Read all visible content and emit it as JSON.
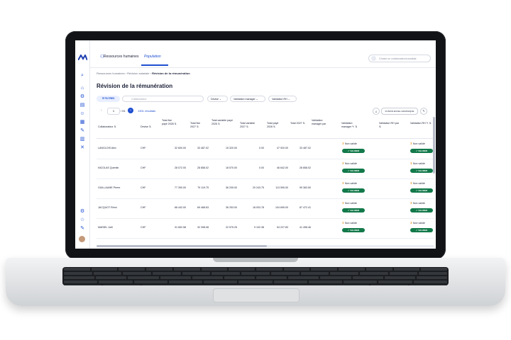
{
  "topbar": {
    "module_label": "Ressources humaines",
    "tab_active": "Population",
    "search_placeholder": "Choisir un collaborateur/candidat"
  },
  "breadcrumb": [
    "Ressources humaines",
    "Révision salariale",
    "Révision de la rémunération"
  ],
  "page_title": "Révision de la rémunération",
  "toolbar": {
    "filter_label": "FILTRES",
    "search_placeholder": "Collaborateur",
    "dropdowns": [
      "Devise",
      "Validation manager",
      "Validation RH"
    ],
    "page_value": "1",
    "page_total": "/ 51",
    "results": "1301 résultats",
    "export_label": "FUSION EXCEL GRAPHIQUE"
  },
  "table": {
    "columns": [
      "Collaborateur",
      "Devise",
      "Total fixe payé 2026",
      "Total fixe 2027",
      "Total variable payé 2026",
      "Total variable 2027",
      "Total payé 2026",
      "Total 2027",
      "Validation manager par",
      "Validation manager",
      "Validation RH par",
      "Validation RH"
    ],
    "rows": [
      {
        "name": "LANGLOIS Alex",
        "devise": "CHF",
        "fixe26": "32 600.00",
        "fixe27": "33 487.02",
        "var26": "15 320.00",
        "var27": "0.00",
        "payé26": "47 920.00",
        "tot27": "33 487.02",
        "mgr": "Non validé",
        "rh": "Non validé"
      },
      {
        "name": "NICOLAS Quentin",
        "devise": "CHF",
        "fixe26": "28 072.00",
        "fixe27": "28 858.02",
        "var26": "18 570.00",
        "var27": "0.00",
        "payé26": "46 642.00",
        "tot27": "28 858.02",
        "mgr": "Non validé",
        "rh": "Non validé"
      },
      {
        "name": "GUILLAUME Pierre",
        "devise": "CHF",
        "fixe26": "77 390.00",
        "fixe27": "79 119.75",
        "var26": "36 205.00",
        "var27": "20 243.75",
        "payé26": "113 595.00",
        "tot27": "99 363.50",
        "mgr": "Non validé",
        "rh": "Non validé"
      },
      {
        "name": "JACQUOT Rémi",
        "devise": "CHF",
        "fixe26": "68 442.00",
        "fixe27": "69 468.63",
        "var26": "36 253.00",
        "var27": "18 003.78",
        "payé26": "104 695.00",
        "tot27": "87 472.41",
        "mgr": "Non validé",
        "rh": "Non validé"
      },
      {
        "name": "MARIEL Joël",
        "devise": "CHF",
        "fixe26": "31 652.58",
        "fixe27": "32 398.08",
        "var26": "22 575.25",
        "var27": "9 102.38",
        "payé26": "54 227.83",
        "tot27": "41 498.46",
        "mgr": "Non validé",
        "rh": "Non validé"
      }
    ],
    "valider_label": "VALIDER"
  }
}
